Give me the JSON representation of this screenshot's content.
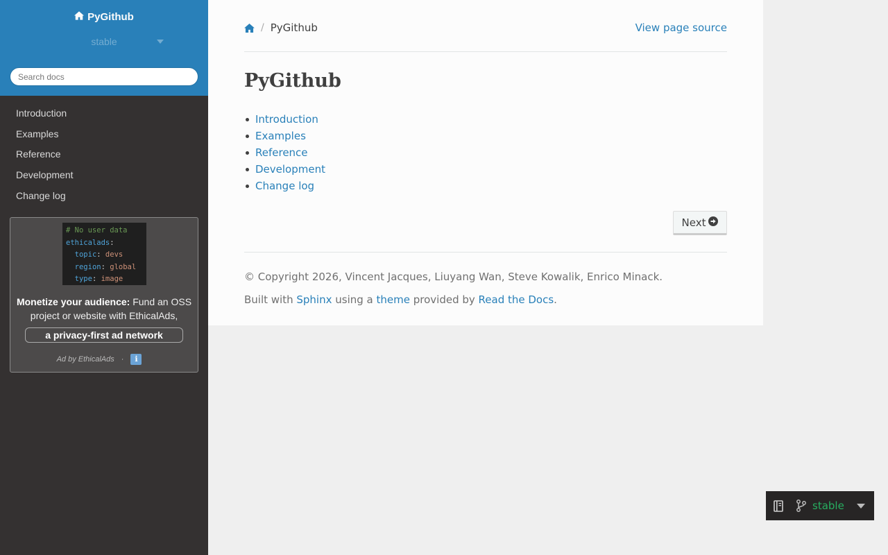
{
  "sidebar": {
    "project_title": "PyGithub",
    "version": "stable",
    "search_placeholder": "Search docs",
    "nav_items": [
      {
        "label": "Introduction"
      },
      {
        "label": "Examples"
      },
      {
        "label": "Reference"
      },
      {
        "label": "Development"
      },
      {
        "label": "Change log"
      }
    ]
  },
  "ad": {
    "code_lines": {
      "l1": "# No user data",
      "l2_key": "ethicalads",
      "l3_key": "topic",
      "l3_val": "devs",
      "l4_key": "region",
      "l4_val": "global",
      "l5_key": "type",
      "l5_val": "image"
    },
    "headline_bold": "Monetize your audience:",
    "headline_rest": " Fund an OSS project or website with EthicalAds,",
    "cta": "a privacy-first ad network",
    "footer": "Ad by EthicalAds",
    "footer_sep": "·",
    "info_icon": "ℹ"
  },
  "breadcrumb": {
    "current": "PyGithub",
    "separator": "/",
    "view_source": "View page source"
  },
  "page": {
    "title": "PyGithub",
    "toc": [
      {
        "label": "Introduction"
      },
      {
        "label": "Examples"
      },
      {
        "label": "Reference"
      },
      {
        "label": "Development"
      },
      {
        "label": "Change log"
      }
    ],
    "next_label": "Next"
  },
  "footer": {
    "copyright": "© Copyright 2026, Vincent Jacques, Liuyang Wan, Steve Kowalik, Enrico Minack.",
    "built_with_prefix": "Built with ",
    "sphinx": "Sphinx",
    "using_a": " using a ",
    "theme": "theme",
    "provided_by": " provided by ",
    "rtd": "Read the Docs",
    "period": "."
  },
  "flyout": {
    "version": "stable"
  },
  "colors": {
    "accent": "#2980b9",
    "sidebar_bg": "#343131",
    "flyout_green": "#27ae60"
  }
}
